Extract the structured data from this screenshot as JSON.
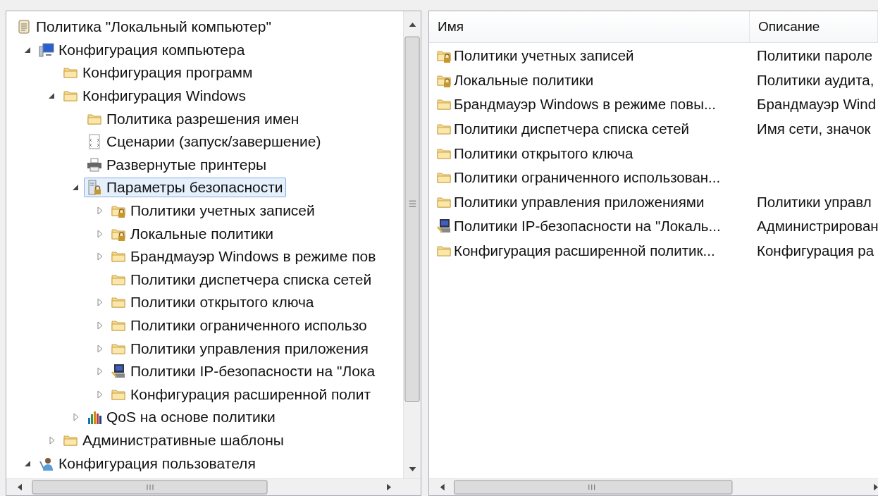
{
  "tree": [
    {
      "label": "Политика \"Локальный компьютер\"",
      "kind": "scroll",
      "selected": false,
      "children": [
        {
          "label": "Конфигурация компьютера",
          "kind": "computer",
          "expandable": true,
          "expanded": true,
          "selected": false,
          "children": [
            {
              "label": "Конфигурация программ",
              "kind": "folder",
              "expandable": false,
              "expanded": false,
              "selected": false
            },
            {
              "label": "Конфигурация Windows",
              "kind": "folder",
              "expandable": true,
              "expanded": true,
              "selected": false,
              "children": [
                {
                  "label": "Политика разрешения имен",
                  "kind": "folder",
                  "expandable": false,
                  "expanded": false,
                  "selected": false
                },
                {
                  "label": "Сценарии (запуск/завершение)",
                  "kind": "script",
                  "expandable": false,
                  "expanded": false,
                  "selected": false
                },
                {
                  "label": "Развернутые принтеры",
                  "kind": "printer",
                  "expandable": false,
                  "expanded": false,
                  "selected": false
                },
                {
                  "label": "Параметры безопасности",
                  "kind": "security",
                  "expandable": true,
                  "expanded": true,
                  "selected": true,
                  "children": [
                    {
                      "label": "Политики учетных записей",
                      "kind": "folder-lock",
                      "expandable": true,
                      "expanded": false,
                      "selected": false
                    },
                    {
                      "label": "Локальные политики",
                      "kind": "folder-lock",
                      "expandable": true,
                      "expanded": false,
                      "selected": false
                    },
                    {
                      "label": "Брандмауэр Windows в режиме пов",
                      "kind": "folder",
                      "expandable": true,
                      "expanded": false,
                      "selected": false
                    },
                    {
                      "label": "Политики диспетчера списка сетей",
                      "kind": "folder",
                      "expandable": false,
                      "expanded": false,
                      "selected": false
                    },
                    {
                      "label": "Политики открытого ключа",
                      "kind": "folder",
                      "expandable": true,
                      "expanded": false,
                      "selected": false
                    },
                    {
                      "label": "Политики ограниченного использо",
                      "kind": "folder",
                      "expandable": true,
                      "expanded": false,
                      "selected": false
                    },
                    {
                      "label": "Политики управления приложения",
                      "kind": "folder",
                      "expandable": true,
                      "expanded": false,
                      "selected": false
                    },
                    {
                      "label": "Политики IP-безопасности на \"Лока",
                      "kind": "ip",
                      "expandable": true,
                      "expanded": false,
                      "selected": false
                    },
                    {
                      "label": "Конфигурация расширенной полит",
                      "kind": "folder",
                      "expandable": true,
                      "expanded": false,
                      "selected": false
                    }
                  ]
                },
                {
                  "label": "QoS на основе политики",
                  "kind": "qos",
                  "expandable": true,
                  "expanded": false,
                  "selected": false
                }
              ]
            },
            {
              "label": "Административные шаблоны",
              "kind": "folder",
              "expandable": true,
              "expanded": false,
              "selected": false
            }
          ]
        },
        {
          "label": "Конфигурация пользователя",
          "kind": "user",
          "expandable": true,
          "expanded": true,
          "selected": false
        }
      ]
    }
  ],
  "list": {
    "columns": [
      "Имя",
      "Описание"
    ],
    "rows": [
      {
        "name": "Политики учетных записей",
        "kind": "folder-lock",
        "description": "Политики пароле"
      },
      {
        "name": "Локальные политики",
        "kind": "folder-lock",
        "description": "Политики аудита,"
      },
      {
        "name": "Брандмауэр Windows в режиме повы...",
        "kind": "folder",
        "description": "Брандмауэр Wind"
      },
      {
        "name": "Политики диспетчера списка сетей",
        "kind": "folder",
        "description": "Имя сети, значок"
      },
      {
        "name": "Политики открытого ключа",
        "kind": "folder"
      },
      {
        "name": "Политики ограниченного использован...",
        "kind": "folder"
      },
      {
        "name": "Политики управления приложениями",
        "kind": "folder",
        "description": "Политики управл"
      },
      {
        "name": "Политики IP-безопасности на \"Локаль...",
        "kind": "ip",
        "description": "Администрирован"
      },
      {
        "name": "Конфигурация расширенной политик...",
        "kind": "folder",
        "description": "Конфигурация ра"
      }
    ]
  }
}
